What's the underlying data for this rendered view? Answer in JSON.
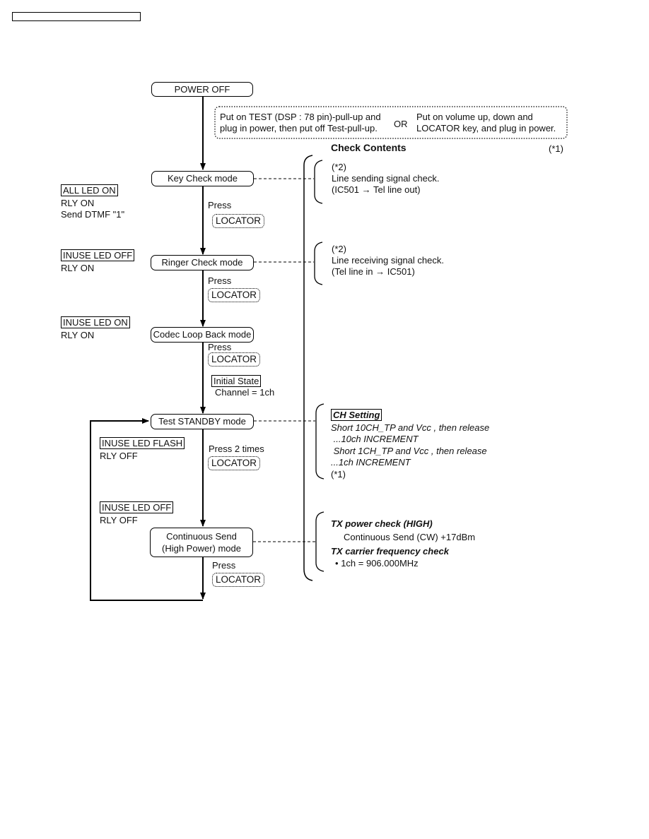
{
  "header_box_text": "",
  "flow": {
    "power_off": "POWER OFF",
    "entry_note": {
      "option_a_line1": "Put on TEST (DSP : 78 pin)-pull-up and",
      "option_a_line2": "plug in power, then put off Test-pull-up.",
      "or_label": "OR",
      "option_b_line1": "Put on volume up, down and",
      "option_b_line2": "LOCATOR key, and plug in power."
    },
    "modes": [
      {
        "label": "Key Check mode"
      },
      {
        "label": "Ringer Check mode"
      },
      {
        "label": "Codec Loop Back mode"
      },
      {
        "label": "Test STANDBY mode"
      },
      {
        "label_line1": "Continuous Send",
        "label_line2": "(High Power) mode"
      }
    ],
    "transitions": [
      {
        "action": "Press",
        "key": "LOCATOR"
      },
      {
        "action": "Press",
        "key": "LOCATOR"
      },
      {
        "action": "Press",
        "key": "LOCATOR"
      },
      {
        "action": "Press 2 times",
        "key": "LOCATOR"
      },
      {
        "action": "Press",
        "key": "LOCATOR"
      }
    ],
    "initial_state": {
      "title": "Initial State",
      "value": "Channel = 1ch"
    }
  },
  "status": [
    {
      "boxed": "ALL LED ON",
      "lines": [
        "RLY ON",
        "Send DTMF \"1\""
      ]
    },
    {
      "boxed": "INUSE LED OFF",
      "lines": [
        "RLY ON"
      ]
    },
    {
      "boxed": "INUSE LED ON",
      "lines": [
        "RLY ON"
      ]
    },
    {
      "boxed": "INUSE LED FLASH",
      "lines": [
        "RLY OFF"
      ]
    },
    {
      "boxed": "INUSE LED OFF",
      "lines": [
        "RLY OFF"
      ]
    }
  ],
  "check_contents": {
    "title": "Check Contents",
    "footnote": "(*1)",
    "key_check": {
      "note": "(*2)",
      "line1": "Line sending signal check.",
      "line2_from": "(IC501",
      "line2_to": "Tel line out)"
    },
    "ringer_check": {
      "note": "(*2)",
      "line1": "Line receiving signal check.",
      "line2_from": "(Tel line in",
      "line2_to": "IC501)"
    },
    "ch_setting": {
      "title": "CH Setting",
      "lines": [
        "Short 10CH_TP and Vcc , then release",
        " ...10ch INCREMENT",
        " Short 1CH_TP and Vcc , then release",
        "...1ch INCREMENT"
      ],
      "footnote": "(*1)"
    },
    "tx": {
      "power_title": "TX power check (HIGH)",
      "power_value": "Continuous Send (CW) +17dBm",
      "freq_title": "TX carrier frequency check",
      "freq_value": "1ch = 906.000MHz"
    }
  }
}
